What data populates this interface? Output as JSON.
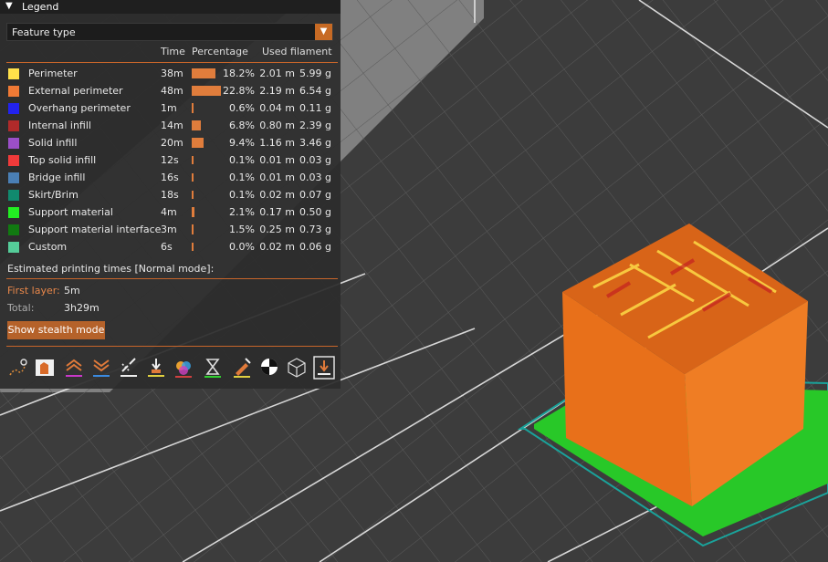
{
  "legend": {
    "title": "Legend",
    "view_type": "Feature type",
    "columns": {
      "time": "Time",
      "percentage": "Percentage",
      "filament": "Used filament"
    },
    "features": [
      {
        "name": "Perimeter",
        "time": "38m",
        "percent": "18.2%",
        "ratio": 0.182,
        "length": "2.01 m",
        "weight": "5.99 g",
        "color": "#ffe14a"
      },
      {
        "name": "External perimeter",
        "time": "48m",
        "percent": "22.8%",
        "ratio": 0.228,
        "length": "2.19 m",
        "weight": "6.54 g",
        "color": "#f07a35"
      },
      {
        "name": "Overhang perimeter",
        "time": "1m",
        "percent": "0.6%",
        "ratio": 0.006,
        "length": "0.04 m",
        "weight": "0.11 g",
        "color": "#2222ee"
      },
      {
        "name": "Internal infill",
        "time": "14m",
        "percent": "6.8%",
        "ratio": 0.068,
        "length": "0.80 m",
        "weight": "2.39 g",
        "color": "#b02a2a"
      },
      {
        "name": "Solid infill",
        "time": "20m",
        "percent": "9.4%",
        "ratio": 0.094,
        "length": "1.16 m",
        "weight": "3.46 g",
        "color": "#9b4fc8"
      },
      {
        "name": "Top solid infill",
        "time": "12s",
        "percent": "0.1%",
        "ratio": 0.001,
        "length": "0.01 m",
        "weight": "0.03 g",
        "color": "#f03a3a"
      },
      {
        "name": "Bridge infill",
        "time": "16s",
        "percent": "0.1%",
        "ratio": 0.001,
        "length": "0.01 m",
        "weight": "0.03 g",
        "color": "#4a7fb5"
      },
      {
        "name": "Skirt/Brim",
        "time": "18s",
        "percent": "0.1%",
        "ratio": 0.001,
        "length": "0.02 m",
        "weight": "0.07 g",
        "color": "#118a6e"
      },
      {
        "name": "Support material",
        "time": "4m",
        "percent": "2.1%",
        "ratio": 0.021,
        "length": "0.17 m",
        "weight": "0.50 g",
        "color": "#22ee22"
      },
      {
        "name": "Support material interface",
        "time": "3m",
        "percent": "1.5%",
        "ratio": 0.015,
        "length": "0.25 m",
        "weight": "0.73 g",
        "color": "#117a11"
      },
      {
        "name": "Custom",
        "time": "6s",
        "percent": "0.0%",
        "ratio": 0.0,
        "length": "0.02 m",
        "weight": "0.06 g",
        "color": "#55cc99"
      }
    ],
    "estimate_label": "Estimated printing times [Normal mode]:",
    "first_layer_label": "First layer:",
    "first_layer_value": "5m",
    "total_label": "Total:",
    "total_value": "3h29m",
    "stealth_button": "Show stealth mode"
  },
  "toolbar": {
    "icons": [
      "travel-icon",
      "wipe-icon",
      "retractions-icon",
      "deretractions-icon",
      "seams-icon",
      "tool-changes-icon",
      "color-changes-icon",
      "pause-prints-icon",
      "custom-gcodes-icon",
      "center-of-gravity-icon",
      "shells-icon",
      "tool-marker-icon"
    ]
  },
  "colors": {
    "accent": "#c8652a",
    "panel": "#2c2c2c",
    "model": "#e86a1a",
    "support": "#22ee22"
  }
}
